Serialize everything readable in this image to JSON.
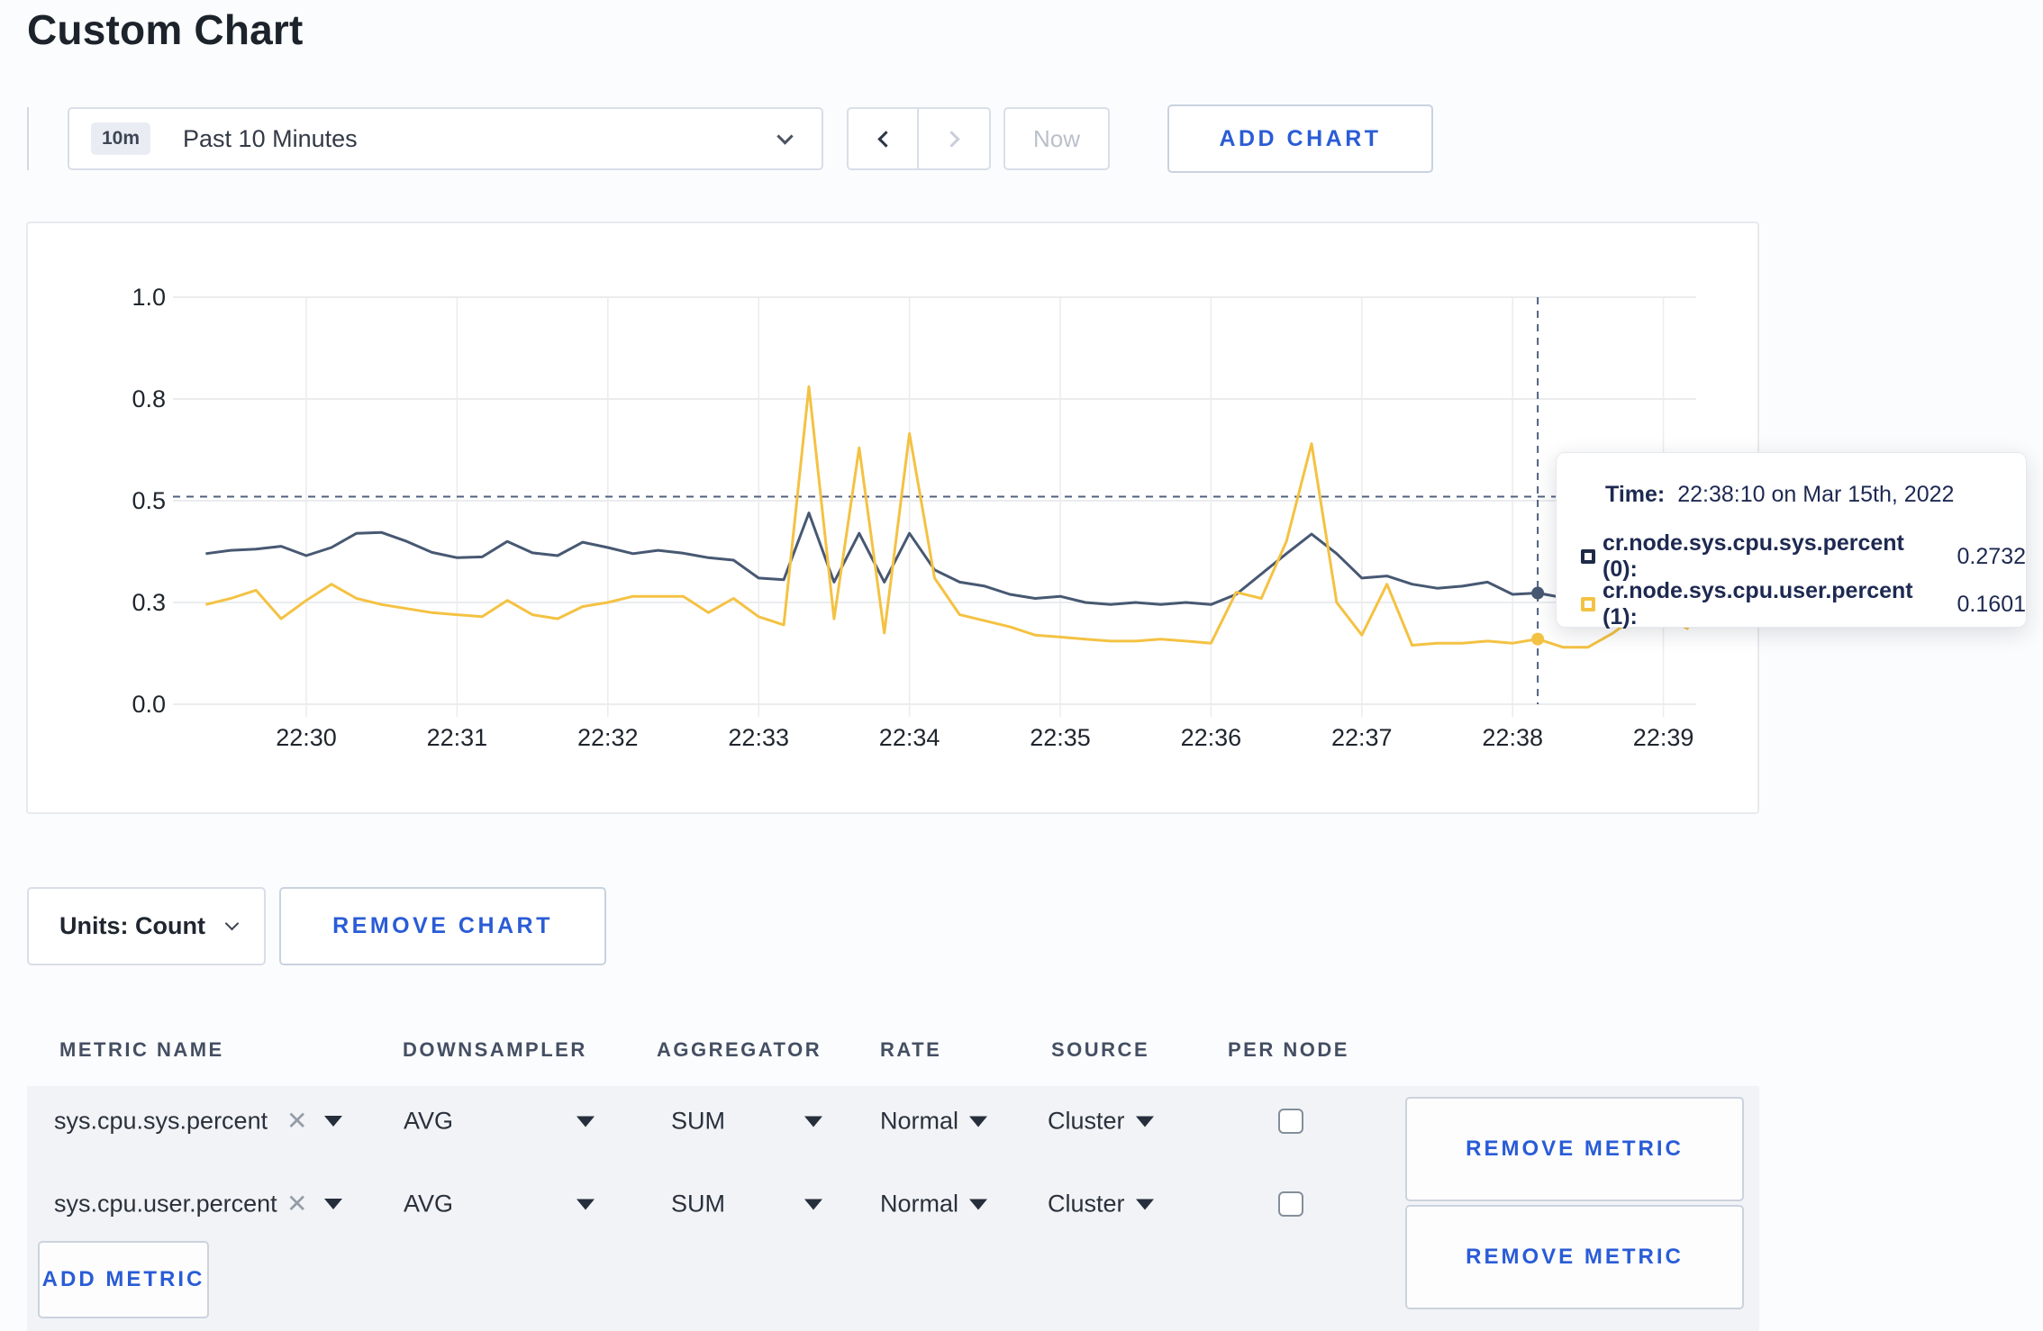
{
  "page": {
    "title": "Custom Chart"
  },
  "toolbar": {
    "time_range": {
      "badge": "10m",
      "label": "Past 10 Minutes"
    },
    "now_label": "Now",
    "add_chart_label": "ADD CHART"
  },
  "chart_controls": {
    "units_label": "Units: Count",
    "remove_chart_label": "REMOVE CHART"
  },
  "tooltip": {
    "time_label": "Time:",
    "time_value": "22:38:10 on Mar 15th, 2022",
    "series": [
      {
        "label": "cr.node.sys.cpu.sys.percent (0):",
        "value": "0.2732",
        "swatch_color": "#1f2a48"
      },
      {
        "label": "cr.node.sys.cpu.user.percent (1):",
        "value": "0.1601",
        "swatch_color": "#f4c243"
      }
    ]
  },
  "metrics_table": {
    "headers": [
      "METRIC NAME",
      "DOWNSAMPLER",
      "AGGREGATOR",
      "RATE",
      "SOURCE",
      "PER NODE"
    ],
    "rows": [
      {
        "metric": "sys.cpu.sys.percent",
        "downsampler": "AVG",
        "aggregator": "SUM",
        "rate": "Normal",
        "source": "Cluster",
        "per_node_checked": false,
        "remove_label": "REMOVE METRIC"
      },
      {
        "metric": "sys.cpu.user.percent",
        "downsampler": "AVG",
        "aggregator": "SUM",
        "rate": "Normal",
        "source": "Cluster",
        "per_node_checked": false,
        "remove_label": "REMOVE METRIC"
      }
    ],
    "add_metric_label": "ADD METRIC"
  },
  "chart_data": {
    "type": "line",
    "title": "",
    "xlabel": "",
    "ylabel": "",
    "ylim": [
      0,
      1
    ],
    "grid": true,
    "legend_position": "none",
    "start_time": "22:29:20",
    "interval_seconds": 10,
    "x_ticks": [
      "22:30",
      "22:31",
      "22:32",
      "22:33",
      "22:34",
      "22:35",
      "22:36",
      "22:37",
      "22:38",
      "22:39"
    ],
    "y_ticks": [
      {
        "value": 0,
        "label": "0.0"
      },
      {
        "value": 0.25,
        "label": "0.3"
      },
      {
        "value": 0.5,
        "label": "0.5"
      },
      {
        "value": 0.75,
        "label": "0.8"
      },
      {
        "value": 1.0,
        "label": "1.0"
      }
    ],
    "series": [
      {
        "name": "cr.node.sys.cpu.sys.percent (0)",
        "color": "#475872",
        "values": [
          0.37,
          0.378,
          0.381,
          0.388,
          0.365,
          0.385,
          0.42,
          0.422,
          0.4,
          0.373,
          0.36,
          0.362,
          0.4,
          0.372,
          0.365,
          0.398,
          0.385,
          0.37,
          0.378,
          0.371,
          0.36,
          0.354,
          0.31,
          0.306,
          0.47,
          0.3,
          0.42,
          0.3,
          0.42,
          0.33,
          0.3,
          0.29,
          0.27,
          0.26,
          0.265,
          0.25,
          0.245,
          0.25,
          0.245,
          0.25,
          0.245,
          0.27,
          0.32,
          0.37,
          0.418,
          0.37,
          0.31,
          0.315,
          0.295,
          0.285,
          0.29,
          0.3,
          0.27,
          0.2732,
          0.262,
          0.268,
          0.275,
          0.285,
          0.295,
          0.3
        ]
      },
      {
        "name": "cr.node.sys.cpu.user.percent (1)",
        "color": "#f4c243",
        "values": [
          0.245,
          0.26,
          0.28,
          0.21,
          0.255,
          0.295,
          0.26,
          0.245,
          0.235,
          0.225,
          0.22,
          0.215,
          0.255,
          0.22,
          0.21,
          0.24,
          0.25,
          0.265,
          0.265,
          0.265,
          0.225,
          0.26,
          0.215,
          0.195,
          0.78,
          0.21,
          0.63,
          0.175,
          0.665,
          0.31,
          0.22,
          0.205,
          0.19,
          0.17,
          0.165,
          0.16,
          0.155,
          0.155,
          0.16,
          0.155,
          0.15,
          0.275,
          0.26,
          0.4,
          0.64,
          0.25,
          0.17,
          0.295,
          0.145,
          0.15,
          0.15,
          0.155,
          0.15,
          0.1601,
          0.14,
          0.14,
          0.175,
          0.22,
          0.215,
          0.185
        ]
      }
    ],
    "crosshair": {
      "time": "22:38:10",
      "hover_value": 0.51,
      "point_values": [
        0.2732,
        0.1601
      ]
    }
  }
}
